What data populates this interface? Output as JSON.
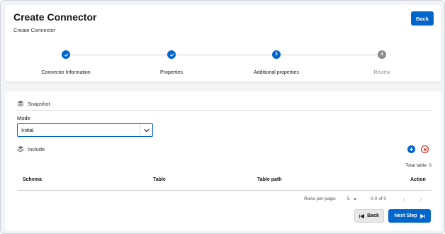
{
  "header": {
    "title": "Create Connector",
    "subtitle": "Create Connector",
    "back_label": "Back"
  },
  "stepper": {
    "steps": [
      {
        "number": "1",
        "label": "Connector Information",
        "status": "done"
      },
      {
        "number": "2",
        "label": "Properties",
        "status": "done"
      },
      {
        "number": "3",
        "label": "Additional properties",
        "status": "current"
      },
      {
        "number": "4",
        "label": "Review",
        "status": "pending"
      }
    ]
  },
  "snapshot": {
    "heading": "Snapshot",
    "mode_label": "Mode",
    "mode_value": "Initial"
  },
  "include": {
    "heading": "Include",
    "total_tables": "Total table: 0",
    "columns": [
      "Schema",
      "Table",
      "Table path",
      "Action"
    ],
    "rows": []
  },
  "pagination": {
    "rows_per_page_label": "Rows per page:",
    "rows_per_page_value": "5",
    "range_text": "0-0 of 0"
  },
  "footer": {
    "back_label": "Back",
    "next_label": "Next Step"
  },
  "colors": {
    "accent": "#0066cc",
    "danger": "#c9190b",
    "pending": "#8a8d90"
  }
}
